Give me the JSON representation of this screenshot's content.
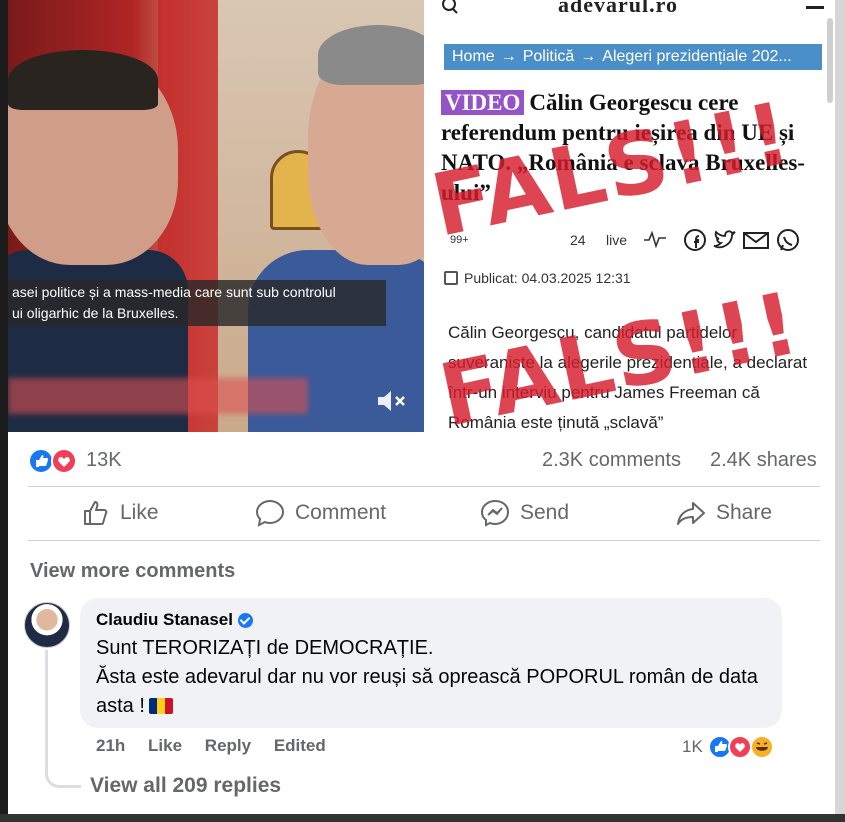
{
  "video": {
    "subtitle_line1": "asei politice și a mass-media care sunt sub controlul",
    "subtitle_line2": "ui oligarhic de la Bruxelles.",
    "mute_icon": "speaker-muted-icon"
  },
  "article": {
    "logo": "adevarul.ro",
    "breadcrumb": [
      "Home",
      "Politică",
      "Alegeri prezidențiale 202..."
    ],
    "breadcrumb_separator": "→",
    "video_tag": "VIDEO",
    "headline": "Călin Georgescu cere referendum pentru ieșirea din UE și NATO. „România e sclava Bruxelles-ului”",
    "stat_left": "99+",
    "stat_right": "24",
    "live_label": "live",
    "share_icons": [
      "facebook-icon",
      "twitter-icon",
      "email-icon",
      "whatsapp-icon"
    ],
    "published_label": "Publicat:",
    "published_date": "04.03.2025 12:31",
    "body": "Călin Georgescu, candidatul partidelor suveraniste la alegerile prezidențiale, a declarat într-un interviu pentru James Freeman că România este ținută „sclavă”",
    "stamp_text": "FALS!!!",
    "stamp_color": "#d61c2c"
  },
  "post": {
    "reaction_count": "13K",
    "comments_count": "2.3K comments",
    "shares_count": "2.4K shares",
    "actions": {
      "like": "Like",
      "comment": "Comment",
      "send": "Send",
      "share": "Share"
    },
    "view_more_comments": "View more comments"
  },
  "comment": {
    "author": "Claudiu Stanasel",
    "verified": true,
    "line1": "Sunt TERORIZAȚI de DEMOCRAȚIE.",
    "line2": "Ăsta este adevarul dar nu vor reuși să oprească POPORUL român de data asta !",
    "time": "21h",
    "like": "Like",
    "reply": "Reply",
    "edited": "Edited",
    "reaction_count": "1K",
    "view_replies": "View all 209 replies"
  },
  "colors": {
    "fb_blue": "#1877f2",
    "love_red": "#f33e58",
    "breadcrumb_blue": "#4a8fc7",
    "video_tag_purple": "#9454c8",
    "muted_text": "#65676b"
  }
}
